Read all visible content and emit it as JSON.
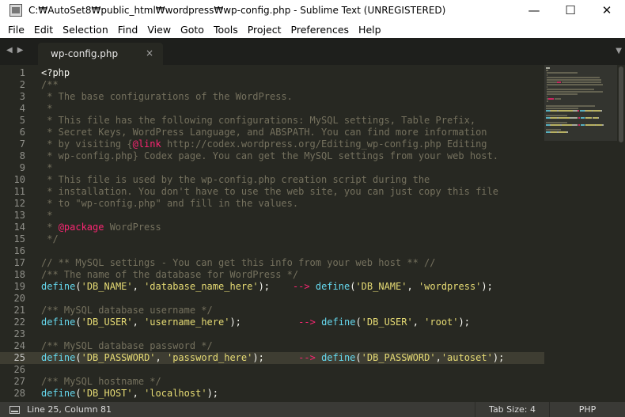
{
  "window": {
    "title": "C:₩AutoSet8₩public_html₩wordpress₩wp-config.php - Sublime Text (UNREGISTERED)",
    "minimize": "—",
    "maximize": "☐",
    "close": "✕"
  },
  "menu": [
    "File",
    "Edit",
    "Selection",
    "Find",
    "View",
    "Goto",
    "Tools",
    "Project",
    "Preferences",
    "Help"
  ],
  "tabs": {
    "back_arrow": "◀",
    "forward_arrow": "▶",
    "active_tab": "wp-config.php",
    "close": "×",
    "dropdown": "▼"
  },
  "editor": {
    "active_line": 25,
    "lines": [
      {
        "n": "1",
        "tokens": [
          {
            "t": "<?php",
            "c": "plain"
          }
        ]
      },
      {
        "n": "2",
        "tokens": [
          {
            "t": "/**",
            "c": "comment"
          }
        ]
      },
      {
        "n": "3",
        "tokens": [
          {
            "t": " * The base configurations of the WordPress.",
            "c": "comment"
          }
        ]
      },
      {
        "n": "4",
        "tokens": [
          {
            "t": " *",
            "c": "comment"
          }
        ]
      },
      {
        "n": "5",
        "tokens": [
          {
            "t": " * This file has the following configurations: MySQL settings, Table Prefix,",
            "c": "comment"
          }
        ]
      },
      {
        "n": "6",
        "tokens": [
          {
            "t": " * Secret Keys, WordPress Language, and ABSPATH. You can find more information",
            "c": "comment"
          }
        ]
      },
      {
        "n": "7",
        "tokens": [
          {
            "t": " * by visiting {",
            "c": "comment"
          },
          {
            "t": "@link",
            "c": "kw"
          },
          {
            "t": " http://codex.wordpress.org/Editing_wp-config.php Editing",
            "c": "comment"
          }
        ]
      },
      {
        "n": "8",
        "tokens": [
          {
            "t": " * wp-config.php} Codex page. You can get the MySQL settings from your web host.",
            "c": "comment"
          }
        ]
      },
      {
        "n": "9",
        "tokens": [
          {
            "t": " *",
            "c": "comment"
          }
        ]
      },
      {
        "n": "10",
        "tokens": [
          {
            "t": " * This file is used by the wp-config.php creation script during the",
            "c": "comment"
          }
        ]
      },
      {
        "n": "11",
        "tokens": [
          {
            "t": " * installation. You don't have to use the web site, you can just copy this file",
            "c": "comment"
          }
        ]
      },
      {
        "n": "12",
        "tokens": [
          {
            "t": " * to \"wp-config.php\" and fill in the values.",
            "c": "comment"
          }
        ]
      },
      {
        "n": "13",
        "tokens": [
          {
            "t": " *",
            "c": "comment"
          }
        ]
      },
      {
        "n": "14",
        "tokens": [
          {
            "t": " * ",
            "c": "comment"
          },
          {
            "t": "@package",
            "c": "kw"
          },
          {
            "t": " WordPress",
            "c": "comment"
          }
        ]
      },
      {
        "n": "15",
        "tokens": [
          {
            "t": " */",
            "c": "comment"
          }
        ]
      },
      {
        "n": "16",
        "tokens": []
      },
      {
        "n": "17",
        "tokens": [
          {
            "t": "// ** MySQL settings - You can get this info from your web host ** //",
            "c": "comment"
          }
        ]
      },
      {
        "n": "18",
        "tokens": [
          {
            "t": "/** The name of the database for WordPress */",
            "c": "comment"
          }
        ]
      },
      {
        "n": "19",
        "tokens": [
          {
            "t": "define",
            "c": "fn"
          },
          {
            "t": "(",
            "c": "plain"
          },
          {
            "t": "'DB_NAME'",
            "c": "str"
          },
          {
            "t": ", ",
            "c": "plain"
          },
          {
            "t": "'database_name_here'",
            "c": "str"
          },
          {
            "t": ");    ",
            "c": "plain"
          },
          {
            "t": "-->",
            "c": "kw"
          },
          {
            "t": " ",
            "c": "plain"
          },
          {
            "t": "define",
            "c": "fn"
          },
          {
            "t": "(",
            "c": "plain"
          },
          {
            "t": "'DB_NAME'",
            "c": "str"
          },
          {
            "t": ", ",
            "c": "plain"
          },
          {
            "t": "'wordpress'",
            "c": "str"
          },
          {
            "t": ");",
            "c": "plain"
          }
        ]
      },
      {
        "n": "20",
        "tokens": []
      },
      {
        "n": "21",
        "tokens": [
          {
            "t": "/** MySQL database username */",
            "c": "comment"
          }
        ]
      },
      {
        "n": "22",
        "tokens": [
          {
            "t": "define",
            "c": "fn"
          },
          {
            "t": "(",
            "c": "plain"
          },
          {
            "t": "'DB_USER'",
            "c": "str"
          },
          {
            "t": ", ",
            "c": "plain"
          },
          {
            "t": "'username_here'",
            "c": "str"
          },
          {
            "t": ");          ",
            "c": "plain"
          },
          {
            "t": "-->",
            "c": "kw"
          },
          {
            "t": " ",
            "c": "plain"
          },
          {
            "t": "define",
            "c": "fn"
          },
          {
            "t": "(",
            "c": "plain"
          },
          {
            "t": "'DB_USER'",
            "c": "str"
          },
          {
            "t": ", ",
            "c": "plain"
          },
          {
            "t": "'root'",
            "c": "str"
          },
          {
            "t": ");",
            "c": "plain"
          }
        ]
      },
      {
        "n": "23",
        "tokens": []
      },
      {
        "n": "24",
        "tokens": [
          {
            "t": "/** MySQL database password */",
            "c": "comment"
          }
        ]
      },
      {
        "n": "25",
        "tokens": [
          {
            "t": "define",
            "c": "fn"
          },
          {
            "t": "(",
            "c": "plain"
          },
          {
            "t": "'DB_PASSWORD'",
            "c": "str"
          },
          {
            "t": ", ",
            "c": "plain"
          },
          {
            "t": "'password_here'",
            "c": "str"
          },
          {
            "t": ");      ",
            "c": "plain"
          },
          {
            "t": "-->",
            "c": "kw"
          },
          {
            "t": " ",
            "c": "plain"
          },
          {
            "t": "define",
            "c": "fn"
          },
          {
            "t": "(",
            "c": "plain"
          },
          {
            "t": "'DB_PASSWORD'",
            "c": "str"
          },
          {
            "t": ",",
            "c": "plain"
          },
          {
            "t": "'autoset'",
            "c": "str"
          },
          {
            "t": ");",
            "c": "plain"
          }
        ]
      },
      {
        "n": "26",
        "tokens": []
      },
      {
        "n": "27",
        "tokens": [
          {
            "t": "/** MySQL hostname */",
            "c": "comment"
          }
        ]
      },
      {
        "n": "28",
        "tokens": [
          {
            "t": "define",
            "c": "fn"
          },
          {
            "t": "(",
            "c": "plain"
          },
          {
            "t": "'DB_HOST'",
            "c": "str"
          },
          {
            "t": ", ",
            "c": "plain"
          },
          {
            "t": "'localhost'",
            "c": "str"
          },
          {
            "t": ");",
            "c": "plain"
          }
        ]
      }
    ]
  },
  "status": {
    "position": "Line 25, Column 81",
    "tab_size": "Tab Size: 4",
    "syntax": "PHP"
  },
  "colors": {
    "background": "#272822",
    "comment": "#75715e",
    "function": "#66d9ef",
    "string": "#e6db74",
    "keyword": "#f92672"
  }
}
